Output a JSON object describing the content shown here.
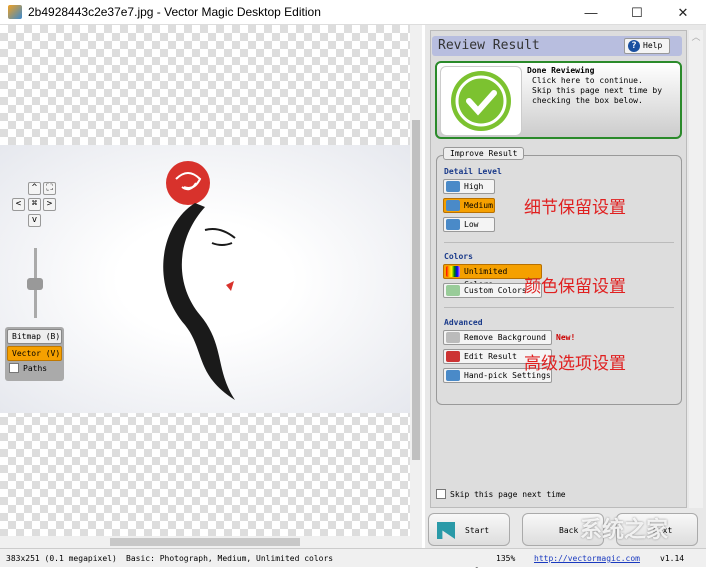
{
  "window": {
    "title": "2b4928443c2e37e7.jpg - Vector Magic Desktop Edition",
    "minimize": "—",
    "maximize": "☐",
    "close": "✕"
  },
  "nav": {
    "up": "^",
    "fit": "⛶",
    "left": "<",
    "center": "⌘",
    "right": ">",
    "down": "v"
  },
  "modes": {
    "bitmap": "Bitmap (B)",
    "vector": "Vector (V)",
    "paths": "Paths"
  },
  "review": {
    "title": "Review Result",
    "help": "Help",
    "done_title": "Done Reviewing",
    "bullets": [
      "Click here to continue.",
      "Skip this page next time by checking the box below."
    ]
  },
  "improve": {
    "label": "Improve Result",
    "detail": {
      "heading": "Detail Level",
      "options": [
        "High",
        "Medium",
        "Low"
      ],
      "selected": "Medium"
    },
    "colors": {
      "heading": "Colors",
      "options": [
        "Unlimited Colors",
        "Custom Colors"
      ],
      "selected": "Unlimited Colors"
    },
    "advanced": {
      "heading": "Advanced",
      "options": [
        "Remove Background",
        "Edit Result",
        "Hand-pick Settings"
      ],
      "new_badge": "New!"
    }
  },
  "annotations": {
    "detail": "细节保留设置",
    "colors": "颜色保留设置",
    "advanced": "高级选项设置"
  },
  "skip_label": "Skip this page next time",
  "bottom": {
    "start": "Start Page",
    "back": "Back",
    "next": "Next"
  },
  "watermark": "系统之家",
  "status": {
    "size": "383x251 (0.1 megapixel)",
    "basic": "Basic: Photograph, Medium, Unlimited colors",
    "zoom": "135%",
    "link": "http://vectormagic.com",
    "version": "v1.14"
  },
  "colors": {
    "accent": "#f5a000",
    "header": "#b8bedf",
    "done_border": "#2a8a2a",
    "annotation": "#e02020"
  }
}
